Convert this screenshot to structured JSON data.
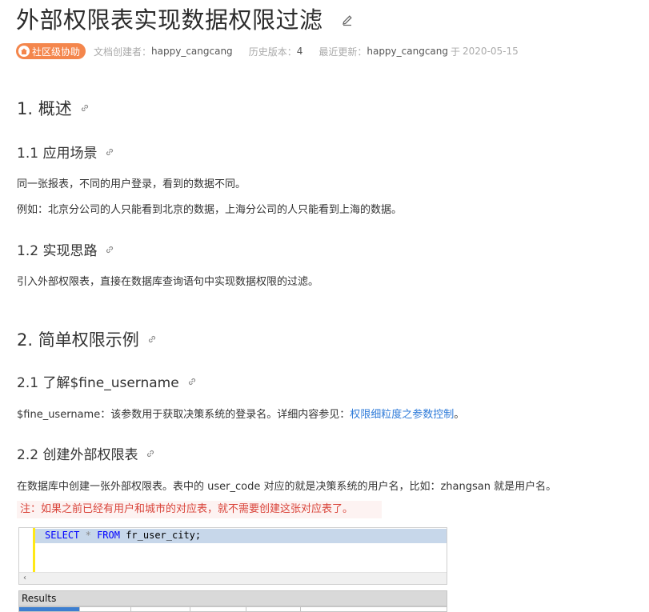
{
  "article": {
    "title": "外部权限表实现数据权限过滤",
    "badge": "社区级协助",
    "meta": {
      "creator_label": "文档创建者：",
      "creator": "happy_cangcang",
      "version_label": "历史版本：",
      "version": "4",
      "updated_label": "最近更新：",
      "updater": "happy_cangcang",
      "updated_prefix": "于",
      "updated_date": "2020-05-15"
    }
  },
  "sections": {
    "s1": {
      "heading": "1. 概述"
    },
    "s1_1": {
      "heading": "1.1 应用场景",
      "p1": "同一张报表，不同的用户登录，看到的数据不同。",
      "p2": "例如：北京分公司的人只能看到北京的数据，上海分公司的人只能看到上海的数据。"
    },
    "s1_2": {
      "heading": "1.2 实现思路",
      "p1": "引入外部权限表，直接在数据库查询语句中实现数据权限的过滤。"
    },
    "s2": {
      "heading": "2. 简单权限示例"
    },
    "s2_1": {
      "heading": "2.1 了解$fine_username",
      "p1_text": "$fine_username：该参数用于获取决策系统的登录名。详细内容参见：",
      "p1_link": "权限细粒度之参数控制",
      "p1_end": "。"
    },
    "s2_2": {
      "heading": "2.2 创建外部权限表",
      "p1": "在数据库中创建一张外部权限表。表中的 user_code 对应的就是决策系统的用户名，比如：zhangsan 就是用户名。",
      "note": "注：如果之前已经有用户和城市的对应表，就不需要创建这张对应表了。"
    }
  },
  "code": {
    "kw_select": "SELECT",
    "star": "*",
    "kw_from": "FROM",
    "table": "fr_user_city;"
  },
  "results": {
    "label": "Results",
    "scroll_arrow": "‹"
  },
  "colors": {
    "badge": "#f4864c",
    "link": "#2f7bd9",
    "note_text": "#d9443a",
    "note_bg": "#fdf3f2"
  }
}
